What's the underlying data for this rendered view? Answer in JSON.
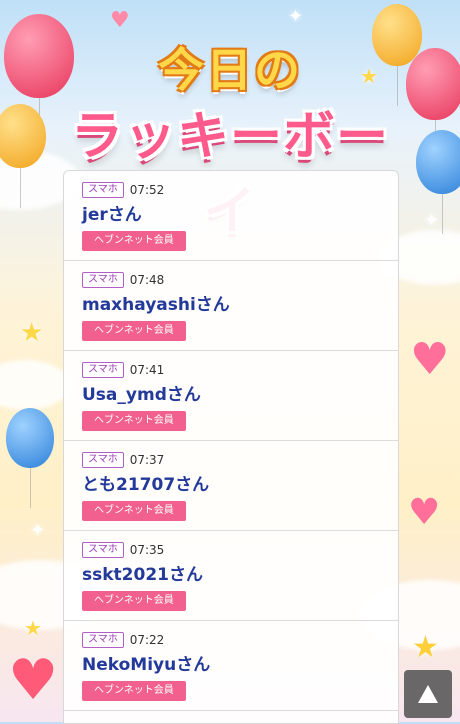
{
  "title": {
    "line1": "今日の",
    "line2": "ラッキーボーイ"
  },
  "entries": [
    {
      "device": "スマホ",
      "time": "07:52",
      "name": "jerさん",
      "badge": "ヘブンネット会員"
    },
    {
      "device": "スマホ",
      "time": "07:48",
      "name": "maxhayashiさん",
      "badge": "ヘブンネット会員"
    },
    {
      "device": "スマホ",
      "time": "07:41",
      "name": "Usa_ymdさん",
      "badge": "ヘブンネット会員"
    },
    {
      "device": "スマホ",
      "time": "07:37",
      "name": "とも21707さん",
      "badge": "ヘブンネット会員"
    },
    {
      "device": "スマホ",
      "time": "07:35",
      "name": "sskt2021さん",
      "badge": "ヘブンネット会員"
    },
    {
      "device": "スマホ",
      "time": "07:22",
      "name": "NekoMiyuさん",
      "badge": "ヘブンネット会員"
    }
  ],
  "controls": {
    "scroll_top_icon": "triangle-up-icon"
  },
  "colors": {
    "badge_pink": "#f2608f",
    "name_blue": "#233a9a",
    "device_purple": "#9b3bb8"
  }
}
